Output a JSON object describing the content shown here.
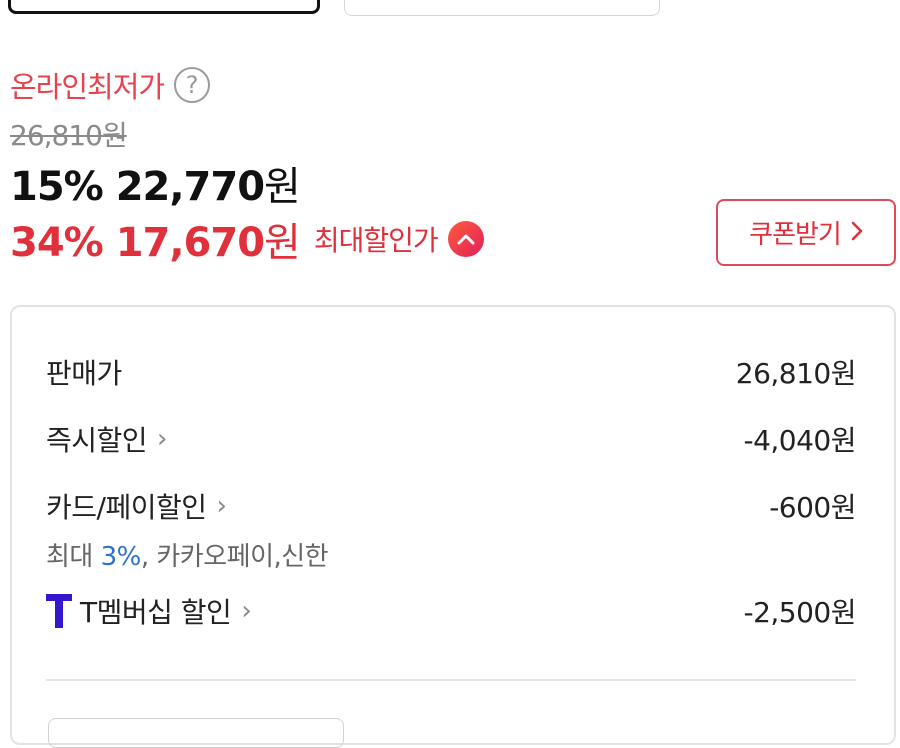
{
  "price": {
    "lowest_label": "온라인최저가",
    "help_symbol": "?",
    "original": "26,810원",
    "sale_percent": "15%",
    "sale_amount": "22,770",
    "sale_won": "원",
    "max_percent": "34%",
    "max_amount": "17,670",
    "max_won": "원",
    "max_label": "최대할인가"
  },
  "coupon": {
    "label": "쿠폰받기"
  },
  "breakdown": {
    "rows": [
      {
        "label": "판매가",
        "value": "26,810원"
      },
      {
        "label": "즉시할인",
        "value": "-4,040원"
      },
      {
        "label": "카드/페이할인",
        "value": "-600원"
      },
      {
        "label": "T멤버십 할인",
        "value": "-2,500원"
      }
    ],
    "card_note_prefix": "최대 ",
    "card_note_pct": "3%",
    "card_note_suffix": ", 카카오페이,신한"
  },
  "icons": [
    "help-icon",
    "chevron-up-icon",
    "chevron-right-icon",
    "t-membership-logo"
  ],
  "colors": {
    "accent": "#e0303b",
    "link": "#2f73c9",
    "tmember": "#3617ce"
  }
}
